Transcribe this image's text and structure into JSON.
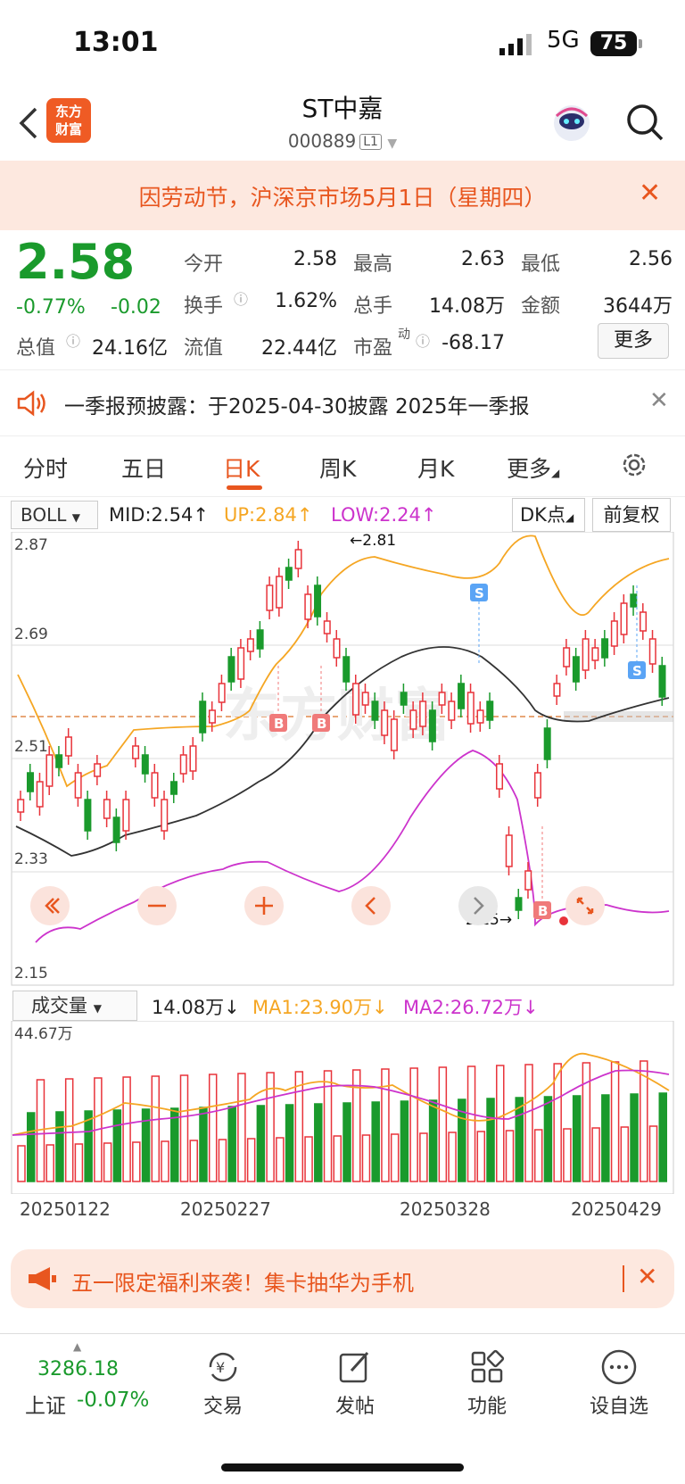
{
  "status": {
    "time": "13:01",
    "network": "5G",
    "battery": "75"
  },
  "header": {
    "title": "ST中嘉",
    "code": "000889",
    "level": "L1",
    "logo_text_1": "东方",
    "logo_text_2": "财富"
  },
  "notice": {
    "text": "因劳动节，沪深京市场5月1日（星期四）",
    "close": "✕"
  },
  "quote": {
    "price": "2.58",
    "change_pct": "-0.77%",
    "change": "-0.02",
    "open_label": "今开",
    "open": "2.58",
    "high_label": "最高",
    "high": "2.63",
    "low_label": "最低",
    "low": "2.56",
    "turnover_label": "换手",
    "turnover": "1.62%",
    "volume_label": "总手",
    "volume": "14.08万",
    "amount_label": "金额",
    "amount": "3644万",
    "mcap_label": "总值",
    "mcap": "24.16亿",
    "float_label": "流值",
    "float": "22.44亿",
    "pe_label": "市盈",
    "pe_sup": "动",
    "pe": "-68.17",
    "more": "更多"
  },
  "announcement": {
    "text": "一季报预披露：于2025-04-30披露 2025年一季报",
    "close": "✕"
  },
  "tabs": [
    "分时",
    "五日",
    "日K",
    "周K",
    "月K",
    "更多"
  ],
  "indicator": {
    "name": "BOLL",
    "mid": "MID:2.54↑",
    "up": "UP:2.84↑",
    "low": "LOW:2.24↑",
    "dk": "DK点",
    "adjust": "前复权"
  },
  "chart_data": {
    "type": "candlestick",
    "y_ticks": [
      "2.87",
      "2.69",
      "2.51",
      "2.33",
      "2.15"
    ],
    "annotations": {
      "high": "2.81",
      "low": "2.15"
    },
    "ylim": [
      2.15,
      2.87
    ],
    "markers": [
      "B",
      "B",
      "S",
      "S",
      "B"
    ]
  },
  "volume": {
    "name": "成交量",
    "value": "14.08万↓",
    "ma1": "MA1:23.90万↓",
    "ma2": "MA2:26.72万↓",
    "max_label": "44.67万"
  },
  "dates": [
    "20250122",
    "20250227",
    "20250328",
    "20250429"
  ],
  "promo": {
    "text": "五一限定福利来袭！集卡抽华为手机",
    "close": "✕"
  },
  "bottom": {
    "index_value": "3286.18",
    "index_name": "上证",
    "index_change": "-0.07%",
    "nav": [
      "交易",
      "发帖",
      "功能",
      "设自选"
    ]
  },
  "colors": {
    "up": "#e8333a",
    "down": "#1a9a2c",
    "accent": "#e8561f",
    "upper_band": "#f5a623",
    "lower_band": "#cc33cc"
  }
}
